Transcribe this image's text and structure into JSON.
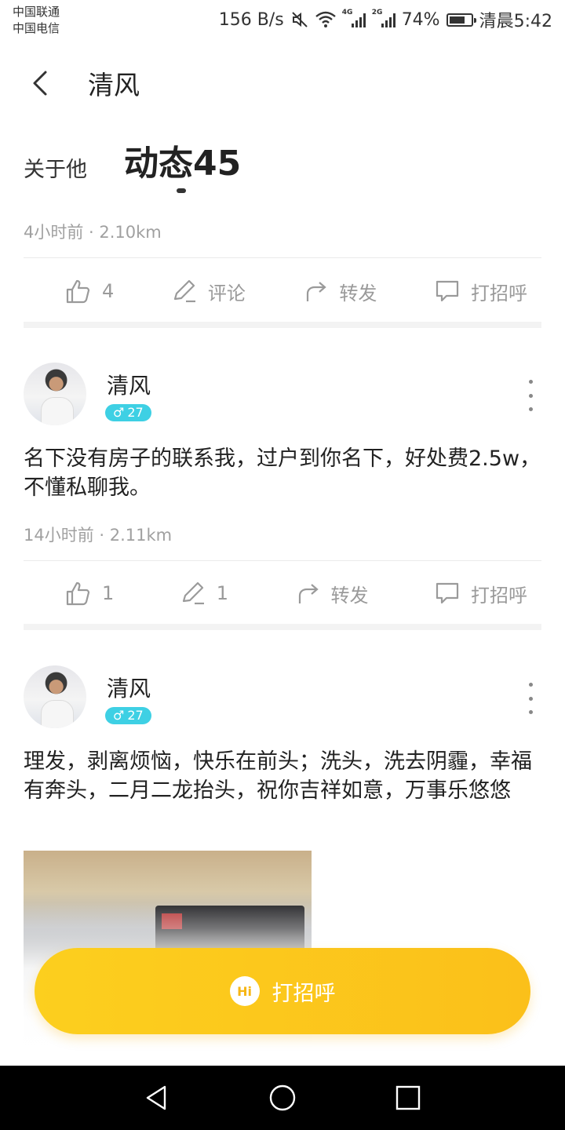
{
  "status_bar": {
    "carrier1": "中国联通",
    "carrier2": "中国电信",
    "speed": "156 B/s",
    "net1": "4G",
    "net2": "2G",
    "battery": "74%",
    "battery_level": 0.74,
    "time": "清晨5:42"
  },
  "header": {
    "title": "清风"
  },
  "tabs": {
    "about": "关于他",
    "moments": "动态45"
  },
  "post1": {
    "meta": "4小时前 · 2.10km",
    "likes": "4",
    "comment": "评论",
    "forward": "转发",
    "greet": "打招呼"
  },
  "post2": {
    "username": "清风",
    "gender_age": "27",
    "text": "名下没有房子的联系我，过户到你名下，好处费2.5w，不懂私聊我。",
    "meta": "14小时前 · 2.11km",
    "likes": "1",
    "comments": "1",
    "forward": "转发",
    "greet": "打招呼"
  },
  "post3": {
    "username": "清风",
    "gender_age": "27",
    "text": "理发，剥离烦恼，快乐在前头；洗头，洗去阴霾，幸福有奔头，二月二龙抬头，祝你吉祥如意，万事乐悠悠"
  },
  "bottom_button": {
    "icon_text": "Hi",
    "label": "打招呼"
  },
  "colors": {
    "accent": "#fcc51c",
    "badge": "#3ed0e4",
    "muted": "#9a9a9a"
  },
  "icons": [
    "back-icon",
    "like-icon",
    "comment-icon",
    "forward-icon",
    "chat-icon",
    "more-icon",
    "hi-icon",
    "nav-back-icon",
    "nav-home-icon",
    "nav-recent-icon"
  ]
}
